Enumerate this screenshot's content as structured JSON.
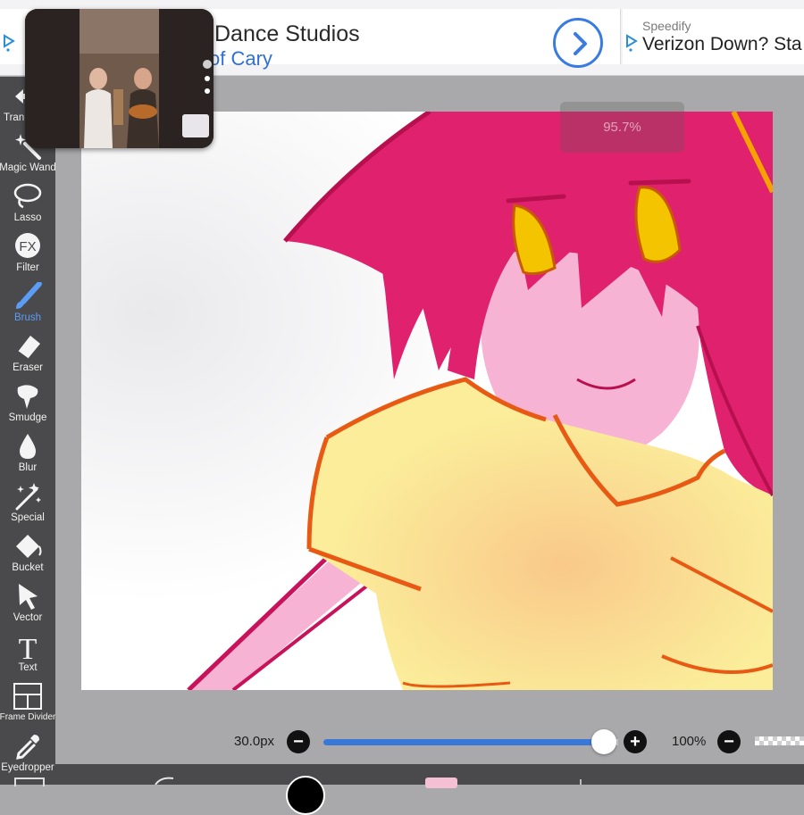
{
  "ad_banner": {
    "title": "Dance Studios",
    "subtitle": "of Cary",
    "arrow_icon": "chevron-right-icon",
    "second_ad": {
      "brand": "Speedify",
      "title": "Verizon Down? Sta"
    }
  },
  "toolbar": {
    "tools": [
      {
        "label": "Tran",
        "icon": "transform-icon",
        "active": false
      },
      {
        "label": "Magic Wand",
        "icon": "magic-wand-icon",
        "active": false
      },
      {
        "label": "Lasso",
        "icon": "lasso-icon",
        "active": false
      },
      {
        "label": "Filter",
        "icon": "fx-icon",
        "icon_text": "FX",
        "active": false
      },
      {
        "label": "Brush",
        "icon": "brush-icon",
        "active": true
      },
      {
        "label": "Eraser",
        "icon": "eraser-icon",
        "active": false
      },
      {
        "label": "Smudge",
        "icon": "smudge-icon",
        "active": false
      },
      {
        "label": "Blur",
        "icon": "blur-drop-icon",
        "active": false
      },
      {
        "label": "Special",
        "icon": "sparkle-icon",
        "active": false
      },
      {
        "label": "Bucket",
        "icon": "bucket-icon",
        "active": false
      },
      {
        "label": "Vector",
        "icon": "cursor-arrow-icon",
        "active": false
      },
      {
        "label": "Text",
        "icon": "text-icon",
        "icon_text": "T",
        "active": false
      },
      {
        "label": "Frame Divider",
        "icon": "frame-divider-icon",
        "active": false
      },
      {
        "label": "Eyedropper",
        "icon": "eyedropper-icon",
        "active": false
      }
    ],
    "active_color": "#5b9cf5"
  },
  "canvas": {
    "zoom_hud": "95.7%",
    "hair_color": "#e0226e",
    "shirt_color": "#fbe98f",
    "outline_color": "#e85a14"
  },
  "brush_controls": {
    "size_label": "30.0px",
    "size_fraction": 0.95,
    "minus_label": "−",
    "plus_label": "+",
    "opacity_label": "100%",
    "opacity_minus_label": "−"
  },
  "pip_video": {
    "icon": "video-pip-icon"
  },
  "colors": {
    "accent": "#3a78d8",
    "toolbar_bg": "#4a4a4c",
    "current_color": "#000000",
    "secondary_swatch": "#f6c0d4"
  }
}
